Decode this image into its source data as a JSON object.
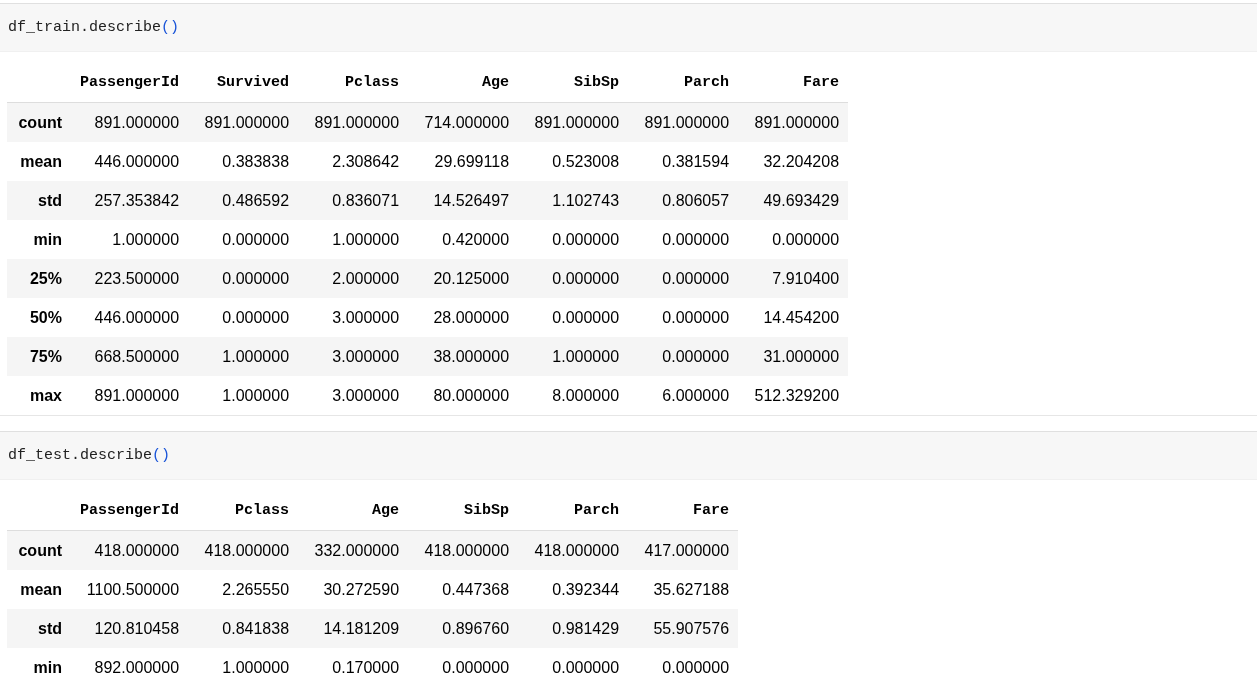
{
  "cells": [
    {
      "code": [
        {
          "kind": "plain",
          "text": "df_train.describe"
        },
        {
          "kind": "bracket",
          "text": "()"
        }
      ],
      "table": {
        "columns": [
          "PassengerId",
          "Survived",
          "Pclass",
          "Age",
          "SibSp",
          "Parch",
          "Fare"
        ],
        "rows": [
          {
            "label": "count",
            "values": [
              "891.000000",
              "891.000000",
              "891.000000",
              "714.000000",
              "891.000000",
              "891.000000",
              "891.000000"
            ]
          },
          {
            "label": "mean",
            "values": [
              "446.000000",
              "0.383838",
              "2.308642",
              "29.699118",
              "0.523008",
              "0.381594",
              "32.204208"
            ]
          },
          {
            "label": "std",
            "values": [
              "257.353842",
              "0.486592",
              "0.836071",
              "14.526497",
              "1.102743",
              "0.806057",
              "49.693429"
            ]
          },
          {
            "label": "min",
            "values": [
              "1.000000",
              "0.000000",
              "1.000000",
              "0.420000",
              "0.000000",
              "0.000000",
              "0.000000"
            ]
          },
          {
            "label": "25%",
            "values": [
              "223.500000",
              "0.000000",
              "2.000000",
              "20.125000",
              "0.000000",
              "0.000000",
              "7.910400"
            ]
          },
          {
            "label": "50%",
            "values": [
              "446.000000",
              "0.000000",
              "3.000000",
              "28.000000",
              "0.000000",
              "0.000000",
              "14.454200"
            ]
          },
          {
            "label": "75%",
            "values": [
              "668.500000",
              "1.000000",
              "3.000000",
              "38.000000",
              "1.000000",
              "0.000000",
              "31.000000"
            ]
          },
          {
            "label": "max",
            "values": [
              "891.000000",
              "1.000000",
              "3.000000",
              "80.000000",
              "8.000000",
              "6.000000",
              "512.329200"
            ]
          }
        ]
      }
    },
    {
      "code": [
        {
          "kind": "plain",
          "text": "df_test.describe"
        },
        {
          "kind": "bracket",
          "text": "()"
        }
      ],
      "table": {
        "columns": [
          "PassengerId",
          "Pclass",
          "Age",
          "SibSp",
          "Parch",
          "Fare"
        ],
        "rows": [
          {
            "label": "count",
            "values": [
              "418.000000",
              "418.000000",
              "332.000000",
              "418.000000",
              "418.000000",
              "417.000000"
            ]
          },
          {
            "label": "mean",
            "values": [
              "1100.500000",
              "2.265550",
              "30.272590",
              "0.447368",
              "0.392344",
              "35.627188"
            ]
          },
          {
            "label": "std",
            "values": [
              "120.810458",
              "0.841838",
              "14.181209",
              "0.896760",
              "0.981429",
              "55.907576"
            ]
          },
          {
            "label": "min",
            "values": [
              "892.000000",
              "1.000000",
              "0.170000",
              "0.000000",
              "0.000000",
              "0.000000"
            ]
          }
        ]
      }
    }
  ]
}
